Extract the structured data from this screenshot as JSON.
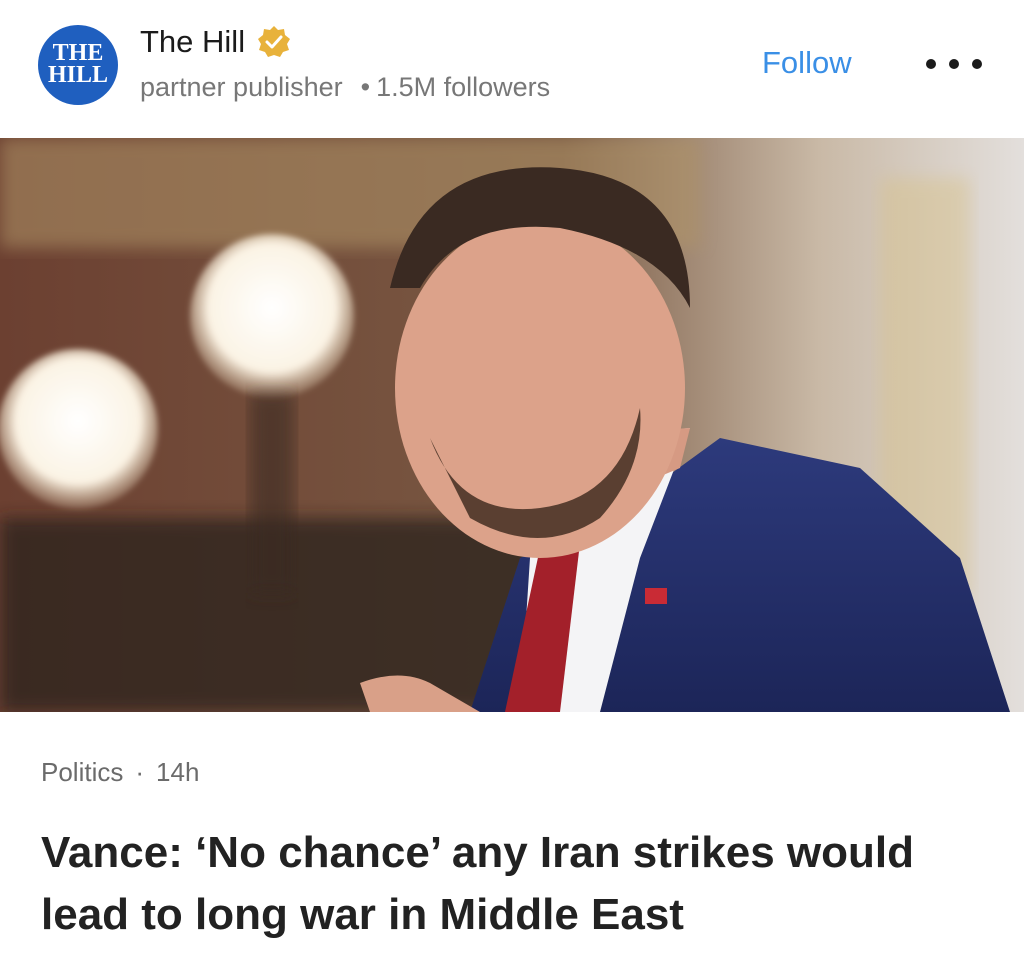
{
  "publisher": {
    "logo_line1": "THE",
    "logo_line2": "HILL",
    "name": "The Hill",
    "verified_icon": "verified-badge-icon",
    "type": "partner publisher",
    "followers": "1.5M followers",
    "follow_label": "Follow",
    "more_icon": "more-options-icon"
  },
  "article": {
    "category": "Politics",
    "separator": "·",
    "age": "14h",
    "headline": "Vance: ‘No chance’ any Iran strikes would lead to long war in Middle East"
  },
  "colors": {
    "accent": "#3a8fe6",
    "logo": "#1f5fbf",
    "badge": "#e8b23b"
  }
}
